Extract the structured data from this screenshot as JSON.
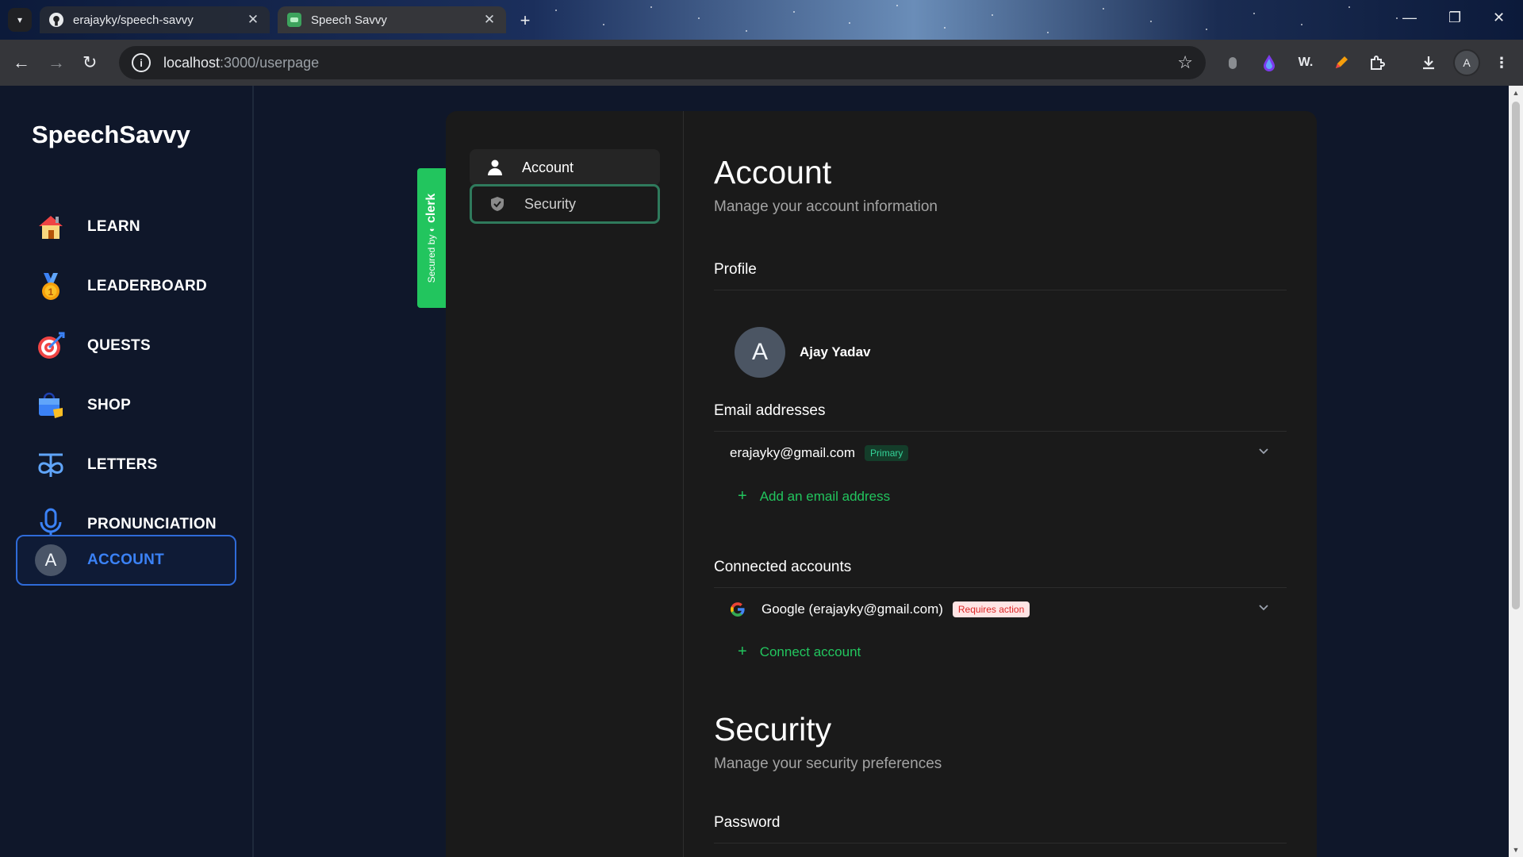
{
  "browser": {
    "tabs": [
      {
        "title": "erajayky/speech-savvy"
      },
      {
        "title": "Speech Savvy"
      }
    ],
    "url_host": "localhost",
    "url_path": ":3000/userpage",
    "profile_initial": "A",
    "ext_w_label": "W."
  },
  "sidebar": {
    "brand": "SpeechSavvy",
    "items": [
      {
        "label": "LEARN",
        "icon": "house-icon"
      },
      {
        "label": "LEADERBOARD",
        "icon": "medal-icon"
      },
      {
        "label": "QUESTS",
        "icon": "target-icon"
      },
      {
        "label": "SHOP",
        "icon": "shopping-bag-icon"
      },
      {
        "label": "LETTERS",
        "icon": "letter-glyph-icon"
      },
      {
        "label": "PRONUNCIATION",
        "icon": "microphone-icon"
      },
      {
        "label": "ACCOUNT",
        "avatar": "A"
      }
    ]
  },
  "clerk": {
    "secured_by": "Secured by",
    "brand": "clerk",
    "nav": [
      {
        "label": "Account",
        "icon": "user-icon"
      },
      {
        "label": "Security",
        "icon": "shield-icon"
      }
    ],
    "account": {
      "title": "Account",
      "subtitle": "Manage your account information",
      "profile_title": "Profile",
      "avatar_initial": "A",
      "name": "Ajay Yadav",
      "email_title": "Email addresses",
      "email": "erajayky@gmail.com",
      "email_badge": "Primary",
      "add_email": "Add an email address",
      "connected_title": "Connected accounts",
      "connected_account": "Google (erajayky@gmail.com)",
      "connected_badge": "Requires action",
      "connect_account": "Connect account"
    },
    "security": {
      "title": "Security",
      "subtitle": "Manage your security preferences",
      "password_title": "Password"
    }
  },
  "colors": {
    "app_bg": "#0f172a",
    "card_bg": "#1a1a1a",
    "accent_green": "#22c55e",
    "accent_blue": "#3b82f6"
  }
}
